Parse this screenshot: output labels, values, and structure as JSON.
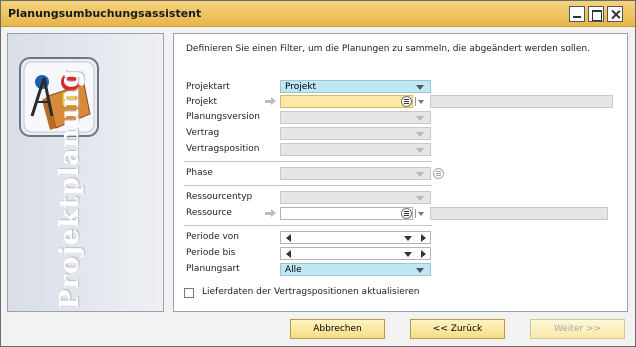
{
  "window": {
    "title": "Planungsumbuchungsassistent",
    "controls": [
      "minimize-icon",
      "maximize-icon",
      "close-icon"
    ]
  },
  "side": {
    "vertical_text": "Projektplanung"
  },
  "intro": "Definieren Sie einen Filter, um die Planungen zu sammeln, die abgeändert werden sollen.",
  "fields": {
    "projektart": {
      "label": "Projektart",
      "value": "Projekt"
    },
    "projekt": {
      "label": "Projekt",
      "value": ""
    },
    "planungsversion": {
      "label": "Planungsversion",
      "value": ""
    },
    "vertrag": {
      "label": "Vertrag",
      "value": ""
    },
    "vertragsposition": {
      "label": "Vertragsposition",
      "value": ""
    },
    "phase": {
      "label": "Phase",
      "value": ""
    },
    "ressourcentyp": {
      "label": "Ressourcentyp",
      "value": ""
    },
    "ressource": {
      "label": "Ressource",
      "value": ""
    },
    "periode_von": {
      "label": "Periode von",
      "value": ""
    },
    "periode_bis": {
      "label": "Periode bis",
      "value": ""
    },
    "planungsart": {
      "label": "Planungsart",
      "value": "Alle"
    }
  },
  "checkbox": {
    "label": "Lieferdaten der Vertragspositionen aktualisieren",
    "checked": false
  },
  "buttons": {
    "cancel": "Abbrechen",
    "back": "<< Zurück",
    "next": "Weiter >>"
  },
  "colors": {
    "titlebar": "#e8b64a",
    "active_combo": "#bfe8f4",
    "required_input": "#fde9a5",
    "button": "#f6dd86"
  }
}
